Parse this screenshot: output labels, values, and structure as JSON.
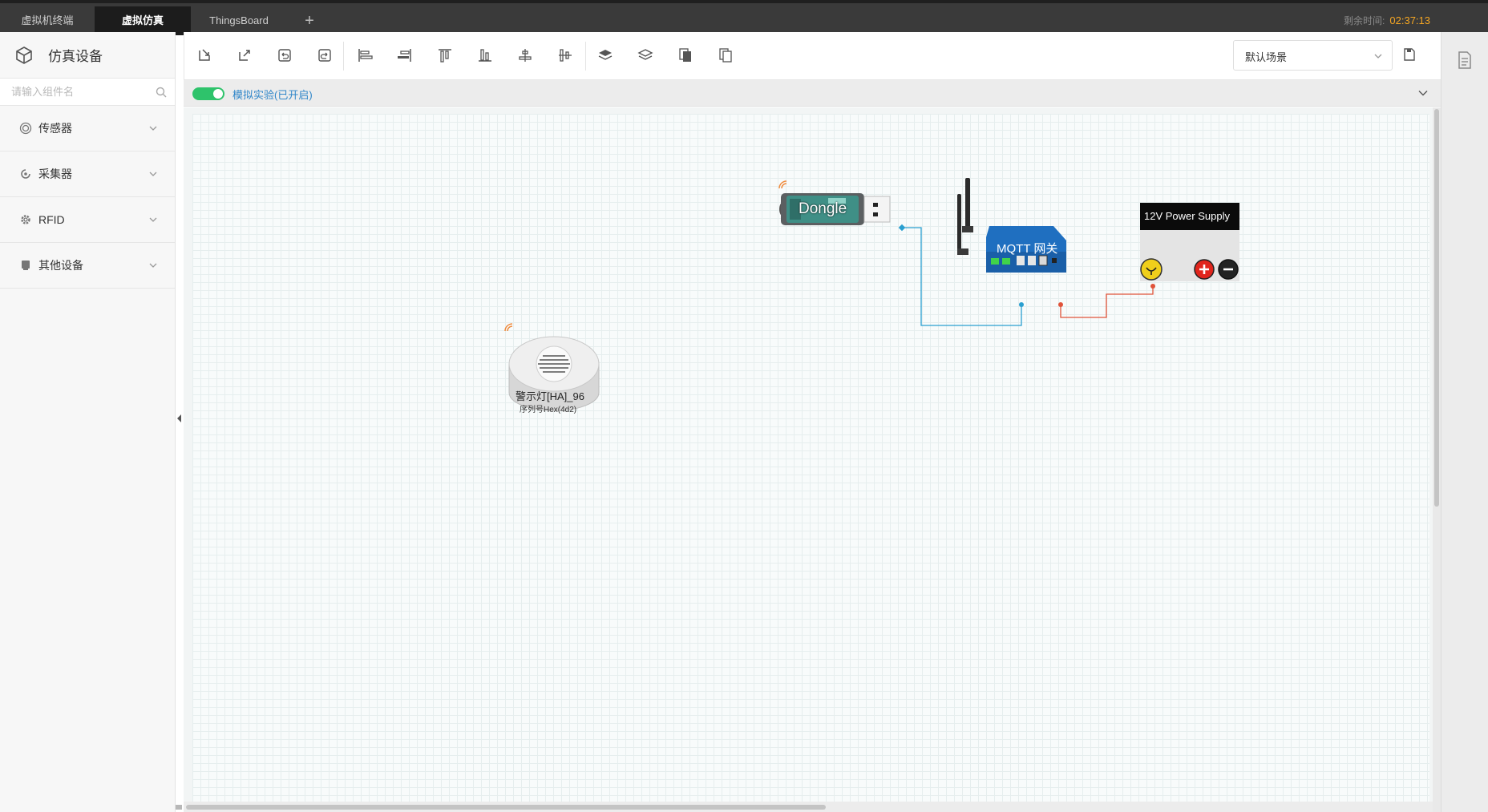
{
  "tabs": [
    {
      "label": "虚拟机终端"
    },
    {
      "label": "虚拟仿真"
    },
    {
      "label": "ThingsBoard"
    }
  ],
  "tab_add": "+",
  "timer": {
    "label": "剩余时间:",
    "value": "02:37:13"
  },
  "sidebar": {
    "title": "仿真设备",
    "search_placeholder": "请输入组件名",
    "categories": [
      {
        "label": "传感器",
        "icon": "sensor-icon"
      },
      {
        "label": "采集器",
        "icon": "collector-icon"
      },
      {
        "label": "RFID",
        "icon": "gear-icon"
      },
      {
        "label": "其他设备",
        "icon": "device-icon"
      }
    ]
  },
  "toolbar": {
    "tools": [
      "import-icon",
      "export-icon",
      "undo-icon",
      "redo-icon",
      "align-left-icon",
      "align-right-icon",
      "align-top-icon",
      "align-bottom-icon",
      "align-center-h-icon",
      "align-center-v-icon",
      "bring-forward-icon",
      "send-backward-icon",
      "copy-icon",
      "paste-icon"
    ],
    "scene": "默认场景"
  },
  "simulation": {
    "label": "模拟实验(已开启)",
    "enabled": true
  },
  "canvas": {
    "devices": [
      {
        "name": "Dongle",
        "label": "Dongle"
      },
      {
        "name": "MQTT 网关",
        "label": "MQTT 网关"
      },
      {
        "name": "12V Power Supply",
        "label": "12V Power Supply"
      },
      {
        "name": "警示灯",
        "label": "警示灯[HA]_96",
        "serial": "序列号Hex(4d2)"
      }
    ]
  },
  "colors": {
    "accent": "#2ec36b",
    "link": "#2f86c9",
    "timer": "#f5a623",
    "wire_signal": "#2a9fd0",
    "wire_power": "#e0533a"
  }
}
